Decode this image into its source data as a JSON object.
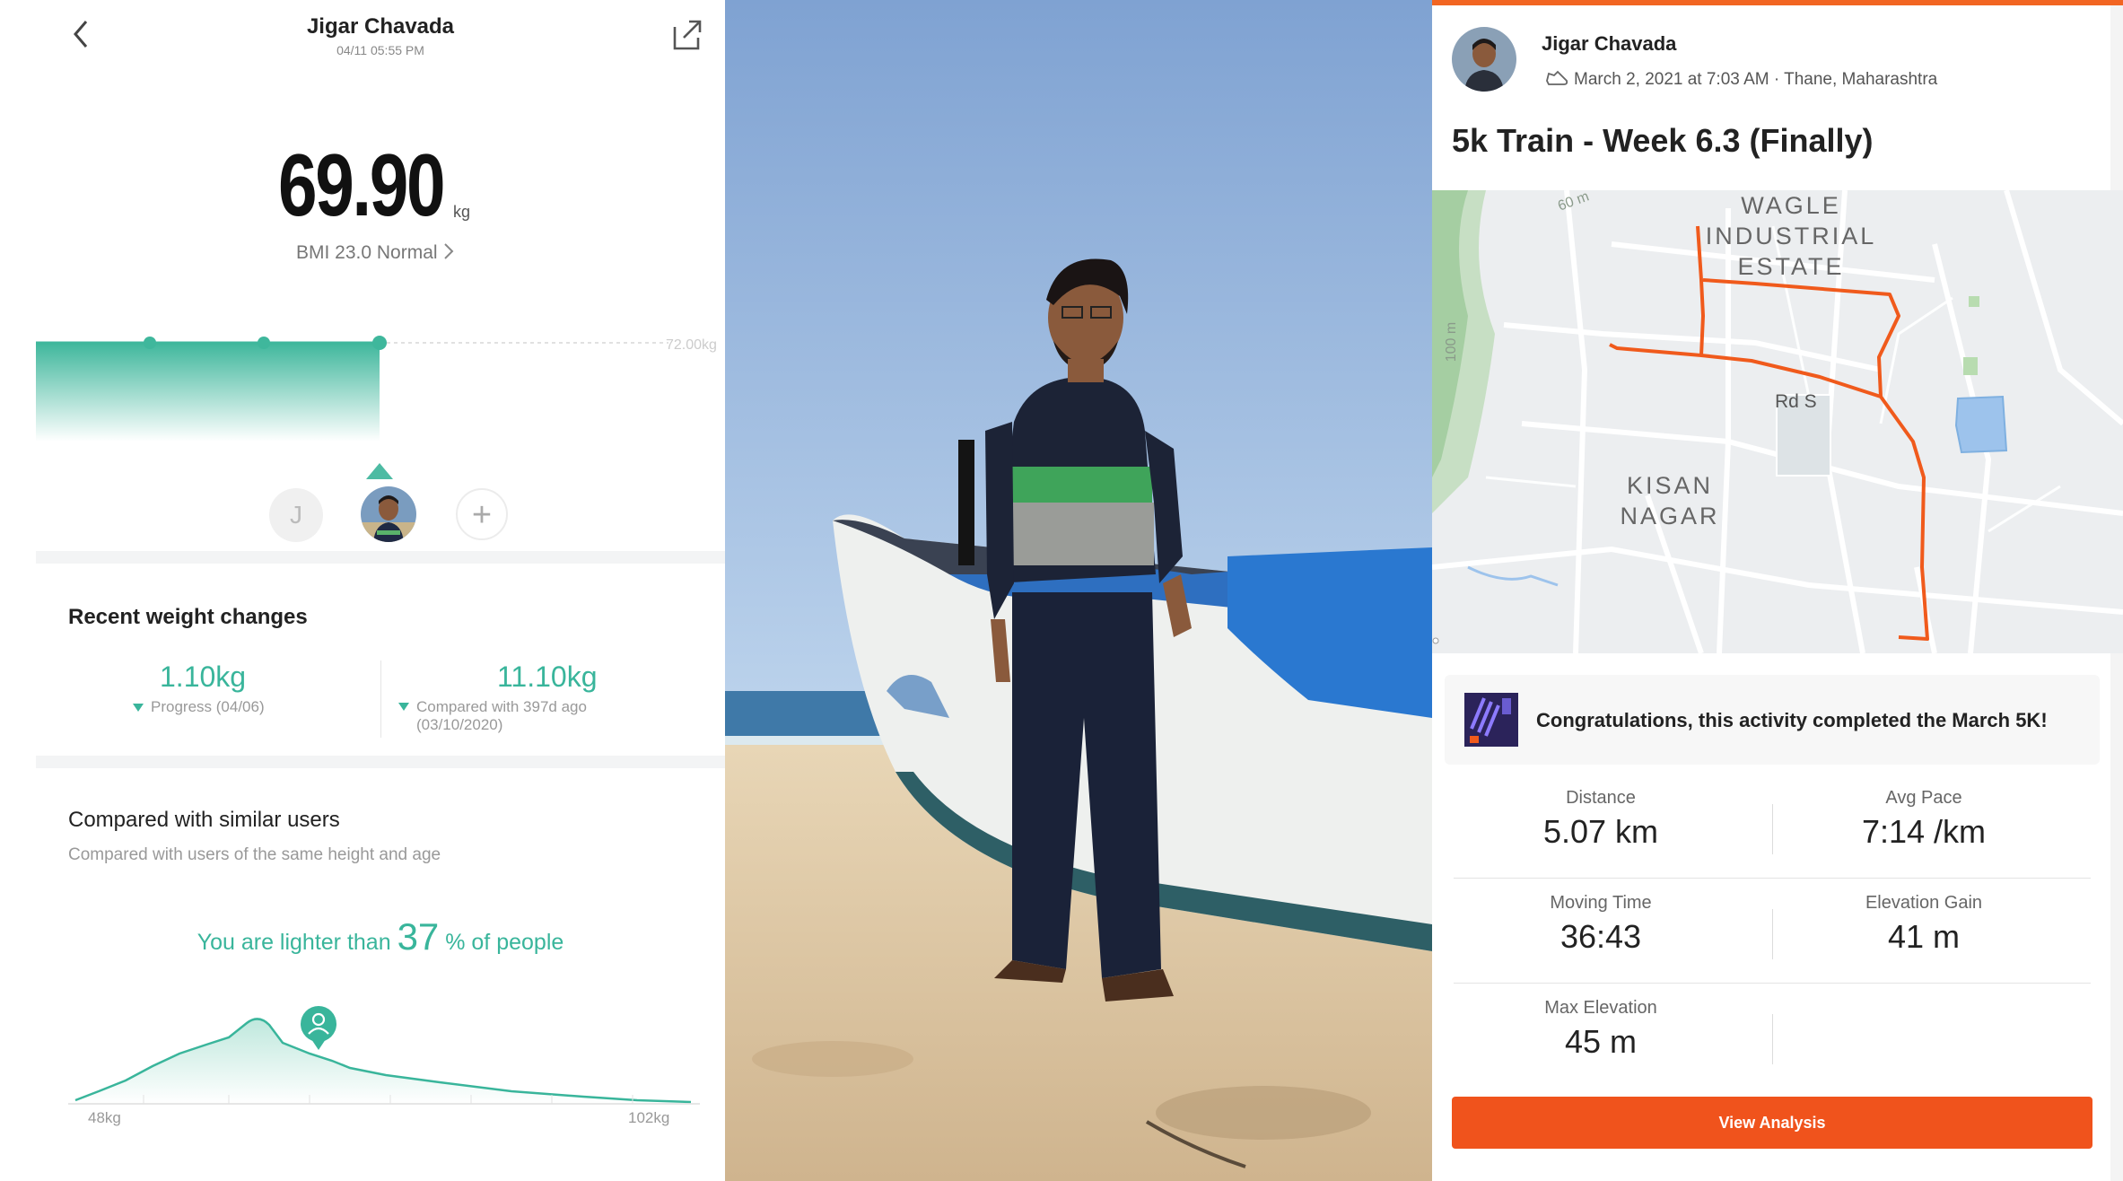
{
  "scale_app": {
    "user_name": "Jigar Chavada",
    "datetime": "04/11 05:55 PM",
    "weight": "69.90",
    "weight_unit": "kg",
    "bmi_text": "BMI 23.0  Normal",
    "chart_target_label": "72.00kg",
    "profile_initial": "J",
    "add_symbol": "+",
    "recent": {
      "title": "Recent weight changes",
      "progress_value": "1.10kg",
      "progress_label": "Progress (04/06)",
      "compared_value": "11.10kg",
      "compared_label_1": "Compared with 397d ago",
      "compared_label_2": "(03/10/2020)"
    },
    "similar": {
      "title": "Compared with similar users",
      "subtitle": "Compared with users of the same height and age",
      "prefix": "You are lighter than ",
      "percent": "37",
      "suffix": " % of people",
      "axis_min": "48kg",
      "axis_max": "102kg"
    },
    "accent": "#39b59b"
  },
  "strava": {
    "athlete_name": "Jigar Chavada",
    "activity_meta": "March 2, 2021 at 7:03 AM · Thane, Maharashtra",
    "activity_title": "5k Train - Week 6.3 (Finally)",
    "map_labels": {
      "wagle_1": "WAGLE",
      "wagle_2": "INDUSTRIAL",
      "wagle_3": "ESTATE",
      "road": "Rd S",
      "kisan_1": "KISAN",
      "kisan_2": "NAGAR",
      "contour_60": "60 m",
      "contour_100": "100 m"
    },
    "achievement": "Congratulations, this activity completed the March 5K!",
    "stats": {
      "distance_label": "Distance",
      "distance_value": "5.07 km",
      "pace_label": "Avg Pace",
      "pace_value": "7:14 /km",
      "moving_label": "Moving Time",
      "moving_value": "36:43",
      "elev_gain_label": "Elevation Gain",
      "elev_gain_value": "41 m",
      "max_elev_label": "Max Elevation",
      "max_elev_value": "45 m"
    },
    "button_label": "View Analysis",
    "accent": "#f0531c"
  }
}
